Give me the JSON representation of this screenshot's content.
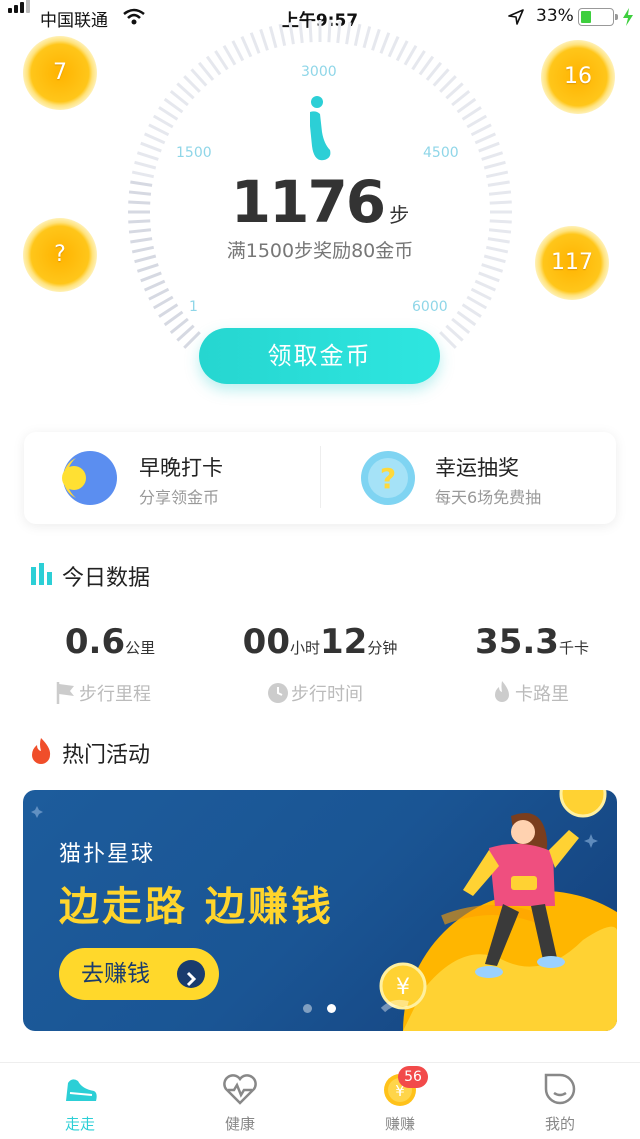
{
  "status_bar": {
    "carrier": "中国联通",
    "time": "上午9:57",
    "battery_percent": "33%",
    "battery_level": 0.33
  },
  "coins": {
    "top_left": "7",
    "top_right": "16",
    "mid_left": "?",
    "mid_right": "117"
  },
  "gauge": {
    "ticks": {
      "t3000": "3000",
      "t1500": "1500",
      "t4500": "4500",
      "t1": "1",
      "t6000": "6000"
    },
    "progress_fraction": 0.196
  },
  "steps": {
    "count": "1176",
    "unit": "步",
    "reward_text": "满1500步奖励80金币"
  },
  "claim_button": "领取金币",
  "tasks": {
    "checkin": {
      "title": "早晚打卡",
      "subtitle": "分享领金币"
    },
    "lottery": {
      "title": "幸运抽奖",
      "subtitle": "每天6场免费抽"
    }
  },
  "today": {
    "title": "今日数据",
    "distance": {
      "value": "0.6",
      "unit": "公里",
      "label": "步行里程"
    },
    "time": {
      "hours": "00",
      "hours_unit": "小时",
      "minutes": "12",
      "minutes_unit": "分钟",
      "label": "步行时间"
    },
    "calories": {
      "value": "35.3",
      "unit": "千卡",
      "label": "卡路里"
    }
  },
  "hot": {
    "title": "热门活动"
  },
  "banner": {
    "subtitle": "猫扑星球",
    "headline": "边走路 边赚钱",
    "button": "去赚钱",
    "active_dot": 2,
    "dot_count": 2
  },
  "tabbar": {
    "walk": "走走",
    "health": "健康",
    "earn": "赚赚",
    "mine": "我的",
    "earn_badge": "56",
    "active": "walk",
    "active_color": "#2ccfd6",
    "inactive_color": "#888888"
  }
}
